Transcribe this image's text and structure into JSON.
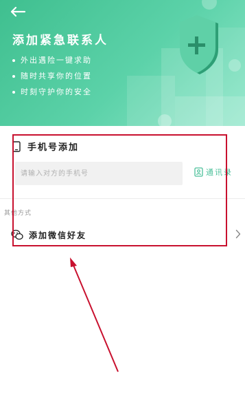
{
  "header": {
    "back_icon": "arrow-left-icon",
    "title": "添加紧急联系人",
    "features": [
      "外出遇险一键求助",
      "随时共享你的位置",
      "时刻守护你的安全"
    ]
  },
  "phone_section": {
    "icon": "phone-icon",
    "label": "手机号添加",
    "input_placeholder": "请输入对方的手机号",
    "contacts_icon": "contacts-icon",
    "contacts_label": "通讯录"
  },
  "other_section": {
    "label": "其他方式",
    "wechat_icon": "wechat-icon",
    "wechat_label": "添加微信好友"
  },
  "colors": {
    "accent": "#4cc09a",
    "hero_start": "#3fbf8f",
    "hero_end": "#8ee6c9",
    "annotation": "#c8102e"
  }
}
